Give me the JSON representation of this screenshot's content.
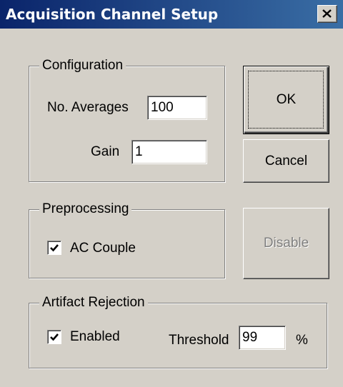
{
  "window": {
    "title": "Acquisition Channel Setup",
    "close_icon": "close-x-icon"
  },
  "configuration": {
    "legend": "Configuration",
    "averages_label": "No. Averages",
    "averages_value": "100",
    "gain_label": "Gain",
    "gain_value": "1"
  },
  "preprocessing": {
    "legend": "Preprocessing",
    "ac_couple_label": "AC Couple",
    "ac_couple_checked": true
  },
  "artifact_rejection": {
    "legend": "Artifact Rejection",
    "enabled_label": "Enabled",
    "enabled_checked": true,
    "threshold_label": "Threshold",
    "threshold_value": "99",
    "threshold_unit": "%"
  },
  "buttons": {
    "ok": "OK",
    "cancel": "Cancel",
    "disable": "Disable"
  },
  "colors": {
    "titlebar": "#0a246a",
    "face": "#d4d0c8",
    "disabled_text": "#808080"
  }
}
